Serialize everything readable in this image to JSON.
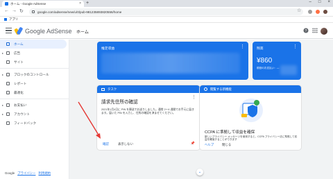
{
  "browser": {
    "tab_title": "ホーム - Google AdSense",
    "tab_close": "×",
    "new_tab": "+",
    "url": "google.com/adsense/new/u/0/pub-981235893820556/home",
    "bookmark_label": "アプリ"
  },
  "header": {
    "brand": "Google AdSense",
    "page_title": "ホーム",
    "help_glyph": "?",
    "apps_glyph": "⋮⋮⋮"
  },
  "sidebar": {
    "items": [
      {
        "label": "ホーム"
      },
      {
        "label": "広告"
      },
      {
        "label": "サイト"
      },
      {
        "label": "ブロックのコントロール"
      },
      {
        "label": "レポート"
      },
      {
        "label": "最適化"
      },
      {
        "label": "お支払い"
      },
      {
        "label": "アカウント"
      },
      {
        "label": "フィードバック"
      }
    ],
    "footer": {
      "google": "Google",
      "privacy": "プライバシー",
      "terms": "利用規約"
    }
  },
  "cards": {
    "estimated": {
      "title": "推定収益"
    },
    "balance": {
      "title": "残高",
      "value": "¥860",
      "sub": "前回のお支払い：―"
    },
    "task": {
      "head": "タスク",
      "title": "請求先住所の確認",
      "body": "2021年1月4日に PIN を郵送でお送りしました。通常 2～4 週間でお手元に届きます。届いた PIN を入力し、住所の確認を済ませてください。",
      "action_primary": "確認",
      "action_secondary": "表示しない",
      "pin_icon": "pin-icon"
    },
    "new_feature": {
      "head": "閲覧する新機能",
      "title": "CCPA に準拠して収益を確保",
      "body": "新しいプライバシー メッセージを使用すると、CCPA プライバシー法に準拠して収益を確保することができます",
      "action_primary": "ヘルプ",
      "action_secondary": "閉じる"
    }
  },
  "colors": {
    "accent": "#1a73e8",
    "annotation_arrow": "#e53935"
  }
}
